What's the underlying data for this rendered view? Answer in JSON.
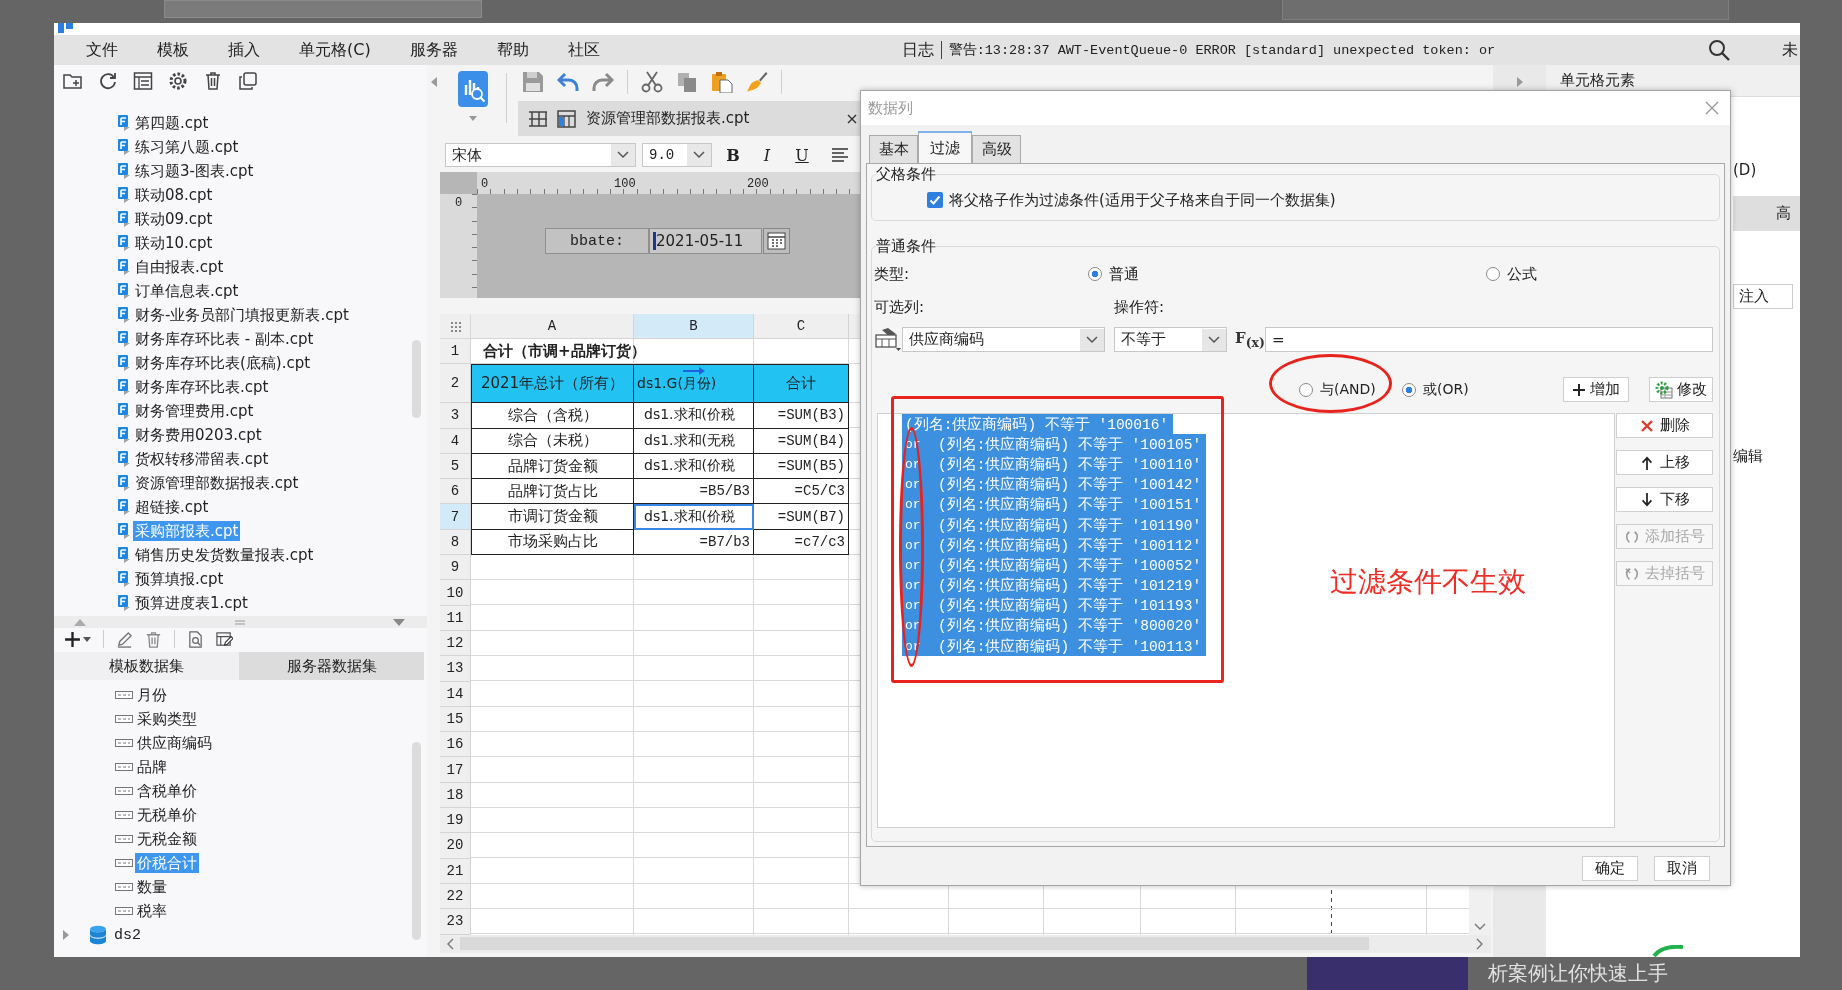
{
  "window": {
    "menu": [
      "文件",
      "模板",
      "插入",
      "单元格(C)",
      "服务器",
      "帮助",
      "社区"
    ],
    "log": {
      "label": "日志",
      "message": "警告:13:28:37 AWT-EventQueue-0 ERROR [standard] unexpected token: or"
    },
    "edge_text": "未"
  },
  "template_tree": [
    {
      "name": "第四题.cpt",
      "selected": false
    },
    {
      "name": "练习第八题.cpt",
      "selected": false
    },
    {
      "name": "练习题3-图表.cpt",
      "selected": false
    },
    {
      "name": "联动08.cpt",
      "selected": false
    },
    {
      "name": "联动09.cpt",
      "selected": false
    },
    {
      "name": "联动10.cpt",
      "selected": false
    },
    {
      "name": "自由报表.cpt",
      "selected": false
    },
    {
      "name": "订单信息表.cpt",
      "selected": false
    },
    {
      "name": "财务-业务员部门填报更新表.cpt",
      "selected": false
    },
    {
      "name": "财务库存环比表 - 副本.cpt",
      "selected": false
    },
    {
      "name": "财务库存环比表(底稿).cpt",
      "selected": false
    },
    {
      "name": "财务库存环比表.cpt",
      "selected": false
    },
    {
      "name": "财务管理费用.cpt",
      "selected": false
    },
    {
      "name": "财务费用0203.cpt",
      "selected": false
    },
    {
      "name": "货权转移滞留表.cpt",
      "selected": false
    },
    {
      "name": "资源管理部数据报表.cpt",
      "selected": false
    },
    {
      "name": "超链接.cpt",
      "selected": false
    },
    {
      "name": "采购部报表.cpt",
      "selected": true
    },
    {
      "name": "销售历史发货数量报表.cpt",
      "selected": false
    },
    {
      "name": "预算填报.cpt",
      "selected": false
    },
    {
      "name": "预算进度表1.cpt",
      "selected": false
    }
  ],
  "dataset_panel": {
    "tabs": [
      {
        "label": "模板数据集",
        "selected": true
      },
      {
        "label": "服务器数据集",
        "selected": false
      }
    ],
    "fields": [
      {
        "name": "月份",
        "selected": false
      },
      {
        "name": "采购类型",
        "selected": false
      },
      {
        "name": "供应商编码",
        "selected": false
      },
      {
        "name": "品牌",
        "selected": false
      },
      {
        "name": "含税单价",
        "selected": false
      },
      {
        "name": "无税单价",
        "selected": false
      },
      {
        "name": "无税金额",
        "selected": false
      },
      {
        "name": "价税合计",
        "selected": true
      },
      {
        "name": "数量",
        "selected": false
      },
      {
        "name": "税率",
        "selected": false
      }
    ],
    "datasource": "ds2"
  },
  "designer": {
    "file_tab": "资源管理部数据报表.cpt",
    "font": "宋体",
    "font_size": "9.0",
    "format_buttons": [
      "B",
      "I",
      "U"
    ],
    "ruler": [
      "0",
      "100",
      "200"
    ],
    "side_ruler": "0",
    "parameter": {
      "label": "bbate:",
      "value": "2021-05-11"
    },
    "sheet": {
      "columns": [
        {
          "label": "A",
          "selected": false
        },
        {
          "label": "B",
          "selected": true
        },
        {
          "label": "C",
          "selected": false
        }
      ],
      "rows": [
        {
          "number": "1",
          "selected": false,
          "cells": [
            {
              "text": "合计（市调+品牌订货）",
              "kind": "title",
              "selected": false
            }
          ]
        },
        {
          "number": "2",
          "selected": false,
          "cells": [
            {
              "text": "2021年总计（所有）",
              "kind": "header",
              "selected": false
            },
            {
              "text": "ds1.G(月份)",
              "kind": "field-header",
              "selected": false
            },
            {
              "text": "合计",
              "kind": "header",
              "selected": false
            }
          ]
        },
        {
          "number": "3",
          "selected": false,
          "cells": [
            {
              "text": "综合（含税）",
              "kind": "label",
              "selected": false
            },
            {
              "text": "ds1.求和(价税",
              "kind": "field",
              "selected": false
            },
            {
              "text": "=SUM(B3)",
              "kind": "formula",
              "selected": false
            }
          ]
        },
        {
          "number": "4",
          "selected": false,
          "cells": [
            {
              "text": "综合（未税）",
              "kind": "label",
              "selected": false
            },
            {
              "text": "ds1.求和(无税",
              "kind": "field",
              "selected": false
            },
            {
              "text": "=SUM(B4)",
              "kind": "formula",
              "selected": false
            }
          ]
        },
        {
          "number": "5",
          "selected": false,
          "cells": [
            {
              "text": "品牌订货金额",
              "kind": "label",
              "selected": false
            },
            {
              "text": "ds1.求和(价税",
              "kind": "field",
              "selected": false
            },
            {
              "text": "=SUM(B5)",
              "kind": "formula",
              "selected": false
            }
          ]
        },
        {
          "number": "6",
          "selected": false,
          "cells": [
            {
              "text": "品牌订货占比",
              "kind": "label",
              "selected": false
            },
            {
              "text": "=B5/B3",
              "kind": "formula",
              "selected": false
            },
            {
              "text": "=C5/C3",
              "kind": "formula",
              "selected": false
            }
          ]
        },
        {
          "number": "7",
          "selected": true,
          "cells": [
            {
              "text": "市调订货金额",
              "kind": "label",
              "selected": false
            },
            {
              "text": "ds1.求和(价税",
              "kind": "field",
              "selected": true
            },
            {
              "text": "=SUM(B7)",
              "kind": "formula",
              "selected": false
            }
          ]
        },
        {
          "number": "8",
          "selected": false,
          "cells": [
            {
              "text": "市场采购占比",
              "kind": "label",
              "selected": false
            },
            {
              "text": "=B7/b3",
              "kind": "formula",
              "selected": false
            },
            {
              "text": "=c7/c3",
              "kind": "formula",
              "selected": false
            }
          ]
        },
        {
          "number": "9",
          "selected": false
        },
        {
          "number": "10",
          "selected": false
        },
        {
          "number": "11",
          "selected": false
        },
        {
          "number": "12",
          "selected": false
        },
        {
          "number": "13",
          "selected": false
        },
        {
          "number": "14",
          "selected": false
        },
        {
          "number": "15",
          "selected": false
        },
        {
          "number": "16",
          "selected": false
        },
        {
          "number": "17",
          "selected": false
        },
        {
          "number": "18",
          "selected": false
        },
        {
          "number": "19",
          "selected": false
        },
        {
          "number": "20",
          "selected": false
        },
        {
          "number": "21",
          "selected": false
        },
        {
          "number": "22",
          "selected": false
        },
        {
          "number": "23",
          "selected": false
        }
      ]
    }
  },
  "dialog": {
    "title": "数据列",
    "tabs": [
      {
        "label": "基本",
        "selected": false
      },
      {
        "label": "过滤",
        "selected": true
      },
      {
        "label": "高级",
        "selected": false
      }
    ],
    "parent_group": {
      "legend": "父格条件",
      "option": {
        "label": "将父格子作为过滤条件(适用于父子格来自于同一个数据集)",
        "checked": true
      }
    },
    "condition_group": {
      "legend": "普通条件",
      "type_label": "类型:",
      "types": [
        {
          "label": "普通",
          "selected": true
        },
        {
          "label": "公式",
          "selected": false
        }
      ],
      "column_label": "可选列:",
      "column": "供应商编码",
      "operator_label": "操作符:",
      "operator": "不等于",
      "formula_button": "F$_{(x)}$",
      "value": "=",
      "joins": [
        {
          "label": "与(AND)",
          "selected": false
        },
        {
          "label": "或(OR)",
          "selected": true
        }
      ],
      "actions": [
        {
          "label": "增加",
          "kind": "add"
        },
        {
          "label": "修改",
          "kind": "edit"
        }
      ],
      "conditions": [
        {
          "text": "(列名:供应商编码) 不等于 '100016'",
          "selected": true
        },
        {
          "join": "or",
          "text": "(列名:供应商编码) 不等于 '100105'",
          "selected": true
        },
        {
          "join": "or",
          "text": "(列名:供应商编码) 不等于 '100110'",
          "selected": true
        },
        {
          "join": "or",
          "text": "(列名:供应商编码) 不等于 '100142'",
          "selected": true
        },
        {
          "join": "or",
          "text": "(列名:供应商编码) 不等于 '100151'",
          "selected": true
        },
        {
          "join": "or",
          "text": "(列名:供应商编码) 不等于 '101190'",
          "selected": true
        },
        {
          "join": "or",
          "text": "(列名:供应商编码) 不等于 '100112'",
          "selected": true
        },
        {
          "join": "or",
          "text": "(列名:供应商编码) 不等于 '100052'",
          "selected": true
        },
        {
          "join": "or",
          "text": "(列名:供应商编码) 不等于 '101219'",
          "selected": true
        },
        {
          "join": "or",
          "text": "(列名:供应商编码) 不等于 '101193'",
          "selected": true
        },
        {
          "join": "or",
          "text": "(列名:供应商编码) 不等于 '800020'",
          "selected": true
        },
        {
          "join": "or",
          "text": "(列名:供应商编码) 不等于 '100113'",
          "selected": true
        }
      ],
      "list_actions": [
        {
          "label": "删除",
          "kind": "delete",
          "disabled": false
        },
        {
          "label": "上移",
          "kind": "up",
          "disabled": false
        },
        {
          "label": "下移",
          "kind": "down",
          "disabled": false
        },
        {
          "label": "添加括号",
          "kind": "add-bracket",
          "disabled": true
        },
        {
          "label": "去掉括号",
          "kind": "remove-bracket",
          "disabled": true
        }
      ]
    },
    "buttons": [
      "确定",
      "取消"
    ]
  },
  "annotation": {
    "note": "过滤条件不生效"
  },
  "right_panel": {
    "title": "单元格元素",
    "fragments": [
      {
        "text": "(D)",
        "kind": "option"
      },
      {
        "text": "高",
        "kind": "tab"
      },
      {
        "text": "注入",
        "kind": "field"
      },
      {
        "text": "编辑",
        "kind": "button"
      }
    ]
  },
  "background": {
    "caption": "析案例让你快速上手"
  }
}
